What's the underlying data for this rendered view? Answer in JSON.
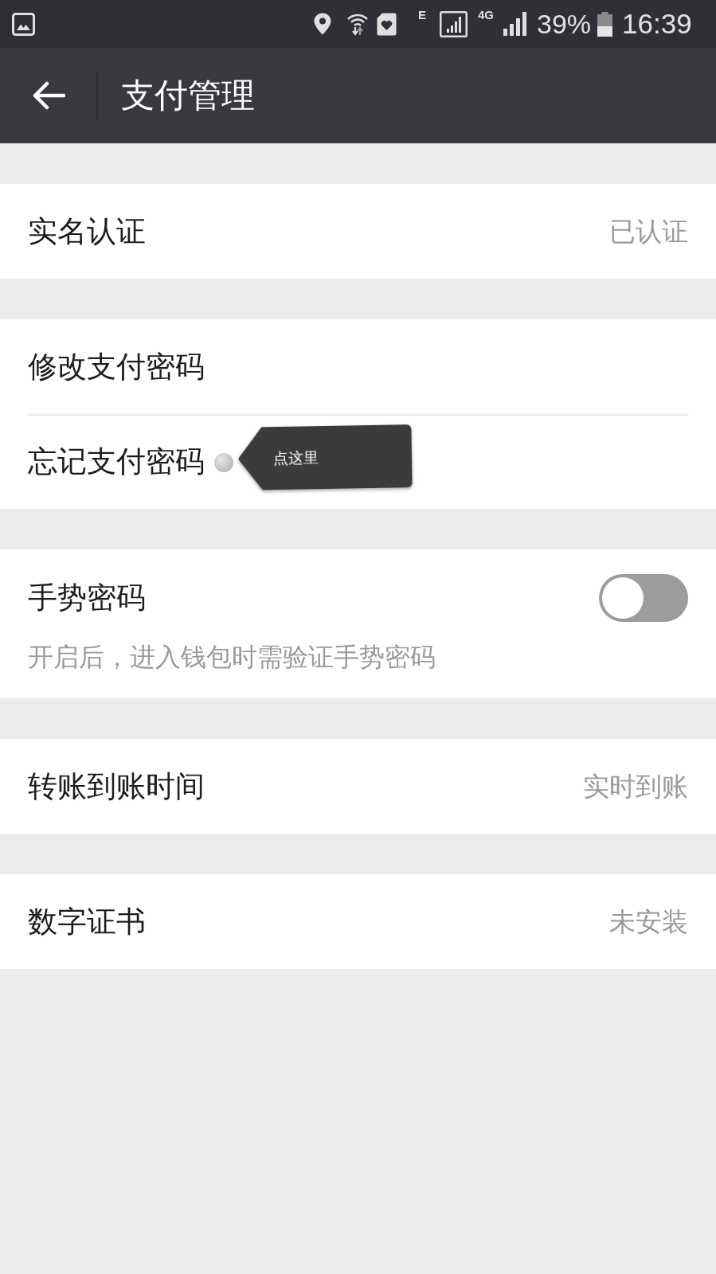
{
  "status_bar": {
    "signals": [
      {
        "kind": "framed",
        "label": "E"
      },
      {
        "kind": "plain",
        "label": "4G"
      }
    ],
    "battery": "39%",
    "time": "16:39"
  },
  "toolbar": {
    "title": "支付管理"
  },
  "groups": [
    {
      "rows": [
        {
          "kind": "value",
          "label": "实名认证",
          "value": "已认证"
        }
      ]
    },
    {
      "rows": [
        {
          "kind": "link",
          "label": "修改支付密码"
        },
        {
          "kind": "link",
          "label": "忘记支付密码",
          "callout": "点这里"
        }
      ]
    },
    {
      "rows": [
        {
          "kind": "toggle",
          "label": "手势密码",
          "on": false,
          "description": "开启后，进入钱包时需验证手势密码"
        }
      ]
    },
    {
      "rows": [
        {
          "kind": "value",
          "label": "转账到账时间",
          "value": "实时到账"
        }
      ]
    },
    {
      "rows": [
        {
          "kind": "value",
          "label": "数字证书",
          "value": "未安装"
        }
      ]
    }
  ]
}
